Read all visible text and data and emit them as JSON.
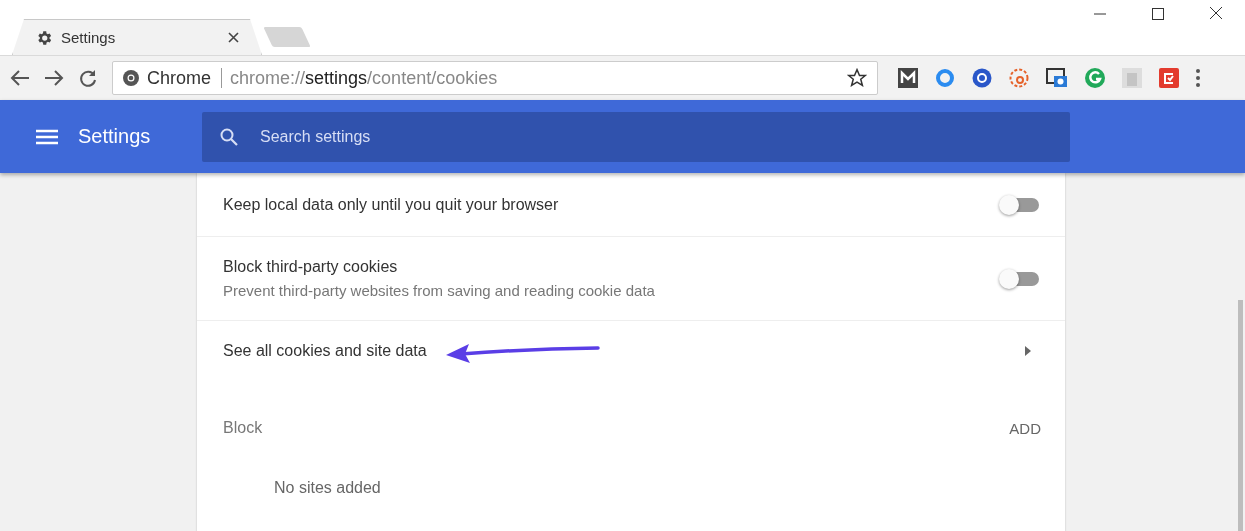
{
  "tab": {
    "title": "Settings"
  },
  "address_bar": {
    "chip": "Chrome",
    "url": "chrome://**settings**/content/cookies"
  },
  "header": {
    "title": "Settings",
    "search": {
      "placeholder": "Search settings"
    }
  },
  "rows": [
    {
      "kind": "toggle",
      "label": "Keep local data only until you quit your browser",
      "on": false
    },
    {
      "kind": "toggle",
      "label": "Block third-party cookies",
      "description": "Prevent third-party websites from saving and reading cookie data",
      "on": false
    },
    {
      "kind": "link",
      "label": "See all cookies and site data"
    }
  ],
  "block_section": {
    "title": "Block",
    "action": "ADD",
    "empty_text": "No sites added"
  }
}
